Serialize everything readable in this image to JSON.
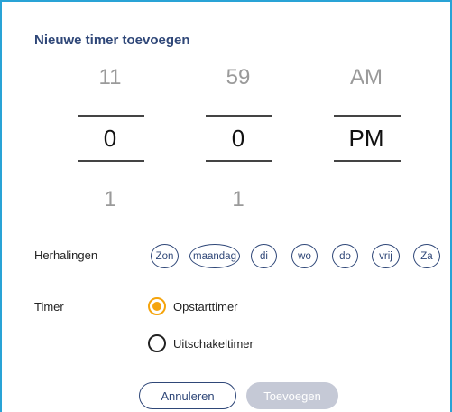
{
  "dialog": {
    "title": "Nieuwe timer toevoegen"
  },
  "picker": {
    "hour": {
      "prev": "11",
      "selected": "0",
      "next": "1"
    },
    "minute": {
      "prev": "59",
      "selected": "0",
      "next": "1"
    },
    "ampm": {
      "prev": "AM",
      "selected": "PM"
    }
  },
  "repeat": {
    "label": "Herhalingen",
    "days": [
      "Zon",
      "maandag",
      "di",
      "wo",
      "do",
      "vrij",
      "Za"
    ]
  },
  "timer": {
    "label": "Timer",
    "options": [
      {
        "label": "Opstarttimer",
        "selected": true
      },
      {
        "label": "Uitschakeltimer",
        "selected": false
      }
    ]
  },
  "buttons": {
    "cancel": "Annuleren",
    "add": "Toevoegen"
  },
  "colors": {
    "accent": "#f5a40c",
    "primary": "#2f4778",
    "border": "#29a3d6",
    "disabled": "#c5c9d6"
  }
}
